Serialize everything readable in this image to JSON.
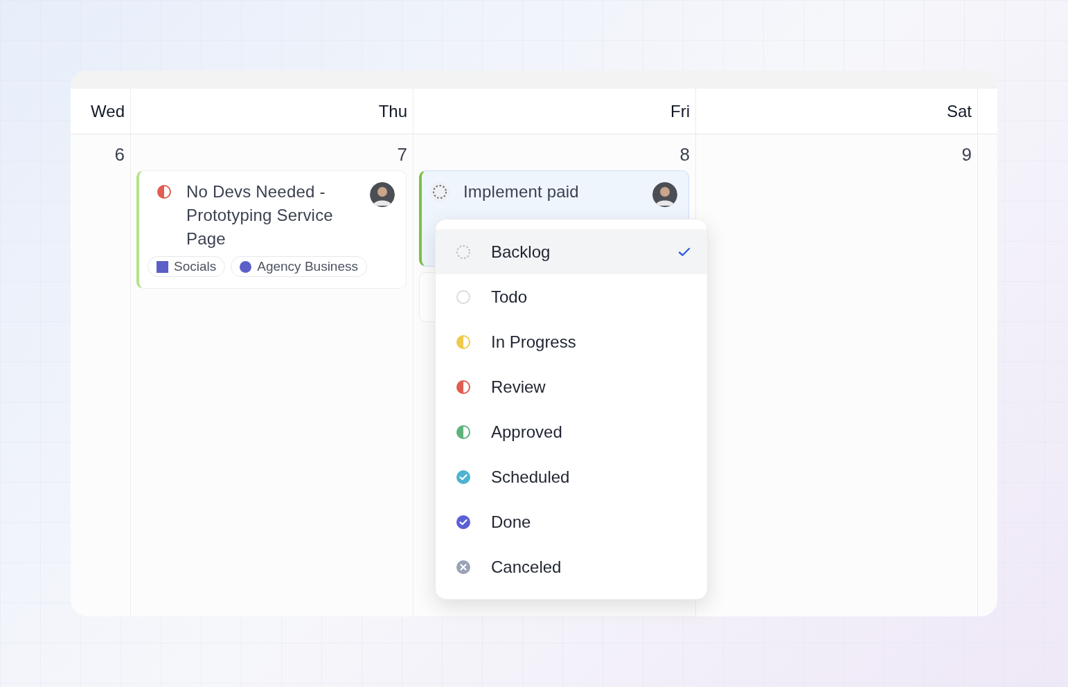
{
  "calendar": {
    "days": [
      {
        "weekday": "Wed",
        "date": "6"
      },
      {
        "weekday": "Thu",
        "date": "7",
        "events": [
          {
            "kind": "task",
            "selected": false,
            "title": "No Devs Needed - Prototyping Service Page",
            "status": {
              "kind": "half",
              "color": "#e05d52"
            },
            "tags": [
              {
                "label": "Socials",
                "kind": "square",
                "color": "#5b5fc7"
              },
              {
                "label": "Agency Business",
                "kind": "circle",
                "color": "#5b5fc7"
              }
            ]
          }
        ]
      },
      {
        "weekday": "Fri",
        "date": "8",
        "events": [
          {
            "kind": "task",
            "selected": true,
            "title": "Implement paid",
            "status": {
              "kind": "backlog",
              "color": "#6b7280"
            }
          },
          {
            "kind": "covered"
          }
        ]
      },
      {
        "weekday": "Sat",
        "date": "9"
      }
    ]
  },
  "status_menu": {
    "options": [
      {
        "label": "Backlog",
        "kind": "backlog",
        "color": "#b8bcc4",
        "selected": true
      },
      {
        "label": "Todo",
        "kind": "empty",
        "color": "#d9dbe0",
        "selected": false
      },
      {
        "label": "In Progress",
        "kind": "half",
        "color": "#f0c94d",
        "selected": false
      },
      {
        "label": "Review",
        "kind": "half",
        "color": "#e05d52",
        "selected": false
      },
      {
        "label": "Approved",
        "kind": "half",
        "color": "#5fb37c",
        "selected": false
      },
      {
        "label": "Scheduled",
        "kind": "check",
        "color": "#4fb3cf",
        "selected": false
      },
      {
        "label": "Done",
        "kind": "check",
        "color": "#5b5fd6",
        "selected": false
      },
      {
        "label": "Canceled",
        "kind": "cancel",
        "color": "#9aa3b5",
        "selected": false
      }
    ]
  }
}
